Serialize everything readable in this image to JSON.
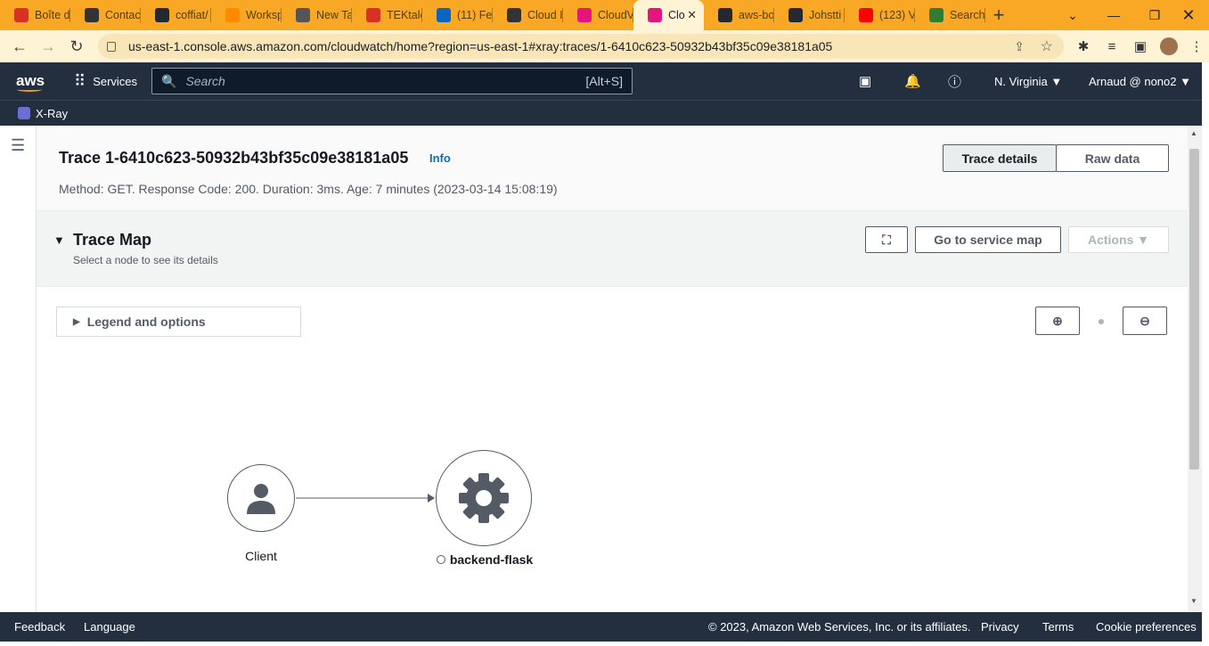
{
  "browser": {
    "tabs": [
      {
        "label": "Boîte d",
        "icon": "gmail-icon",
        "color": "#d93025"
      },
      {
        "label": "Contac",
        "icon": "page-icon",
        "color": "#333333"
      },
      {
        "label": "coffiat/",
        "icon": "github-icon",
        "color": "#24292f"
      },
      {
        "label": "Worksp",
        "icon": "gitpod-icon",
        "color": "#ff8a00"
      },
      {
        "label": "New Ta",
        "icon": "chrome-icon",
        "color": "#555555"
      },
      {
        "label": "TEKtale",
        "icon": "gmail-icon",
        "color": "#d93025"
      },
      {
        "label": "(11) Fe",
        "icon": "linkedin-icon",
        "color": "#0a66c2"
      },
      {
        "label": "Cloud I",
        "icon": "globe-icon",
        "color": "#333333"
      },
      {
        "label": "CloudV",
        "icon": "cloudwatch-icon",
        "color": "#e7157b"
      },
      {
        "label": "Clo",
        "icon": "cloudwatch-icon",
        "color": "#e7157b",
        "active": true
      },
      {
        "label": "aws-bo",
        "icon": "github-icon",
        "color": "#24292f"
      },
      {
        "label": "Johstti",
        "icon": "github-icon",
        "color": "#24292f"
      },
      {
        "label": "(123) V",
        "icon": "youtube-icon",
        "color": "#ff0000"
      },
      {
        "label": "Search",
        "icon": "doc-icon",
        "color": "#2e7d32"
      }
    ],
    "url": "us-east-1.console.aws.amazon.com/cloudwatch/home?region=us-east-1#xray:traces/1-6410c623-50932b43bf35c09e38181a05"
  },
  "aws": {
    "logo": "aws",
    "services_label": "Services",
    "search_placeholder": "Search",
    "search_shortcut": "[Alt+S]",
    "region": "N. Virginia ▼",
    "account": "Arnaud @ nono2 ▼",
    "service_crumb": "X-Ray"
  },
  "header": {
    "title": "Trace 1-6410c623-50932b43bf35c09e38181a05",
    "info_label": "Info",
    "subtitle": "Method: GET. Response Code: 200. Duration: 3ms. Age: 7 minutes (2023-03-14 15:08:19)",
    "tab_details": "Trace details",
    "tab_raw": "Raw data"
  },
  "trace_map": {
    "title": "Trace Map",
    "subtitle": "Select a node to see its details",
    "go_service_map": "Go to service map",
    "actions": "Actions ▼",
    "legend": "Legend and options",
    "nodes": [
      {
        "label": "Client",
        "icon": "user-icon"
      },
      {
        "label": "backend-flask",
        "icon": "gear-icon"
      }
    ]
  },
  "footer": {
    "feedback": "Feedback",
    "language": "Language",
    "copyright": "© 2023, Amazon Web Services, Inc. or its affiliates.",
    "privacy": "Privacy",
    "terms": "Terms",
    "cookies": "Cookie preferences"
  }
}
